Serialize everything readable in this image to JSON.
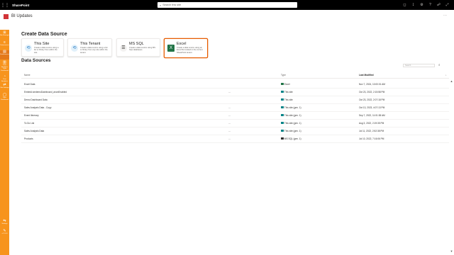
{
  "app": {
    "title": "SharePoint",
    "search_placeholder": "Search this site"
  },
  "site": {
    "name": "BI Updates",
    "more": "⋯"
  },
  "suite_icons": [
    "chat-icon",
    "share-icon",
    "settings-icon",
    "help-icon",
    "network-icon",
    "expand-icon"
  ],
  "leftnav": {
    "items": [
      {
        "icon": "⊞",
        "label": "Site Manager"
      },
      {
        "icon": "≡",
        "label": "Datasources"
      },
      {
        "icon": "▤",
        "label": "DataSources"
      },
      {
        "icon": "▥",
        "label": "Data Analytics Tools Dashboard"
      },
      {
        "icon": "◔",
        "label": "User Analytics"
      },
      {
        "icon": "⇄",
        "label": "Site Settings"
      },
      {
        "icon": "◯",
        "label": "New Dashboard"
      },
      {
        "icon": "⇆",
        "label": "Settings"
      },
      {
        "icon": "✎",
        "label": "v1.1.0.0"
      }
    ]
  },
  "create": {
    "heading": "Create Data Source",
    "cards": [
      {
        "title": "This Site",
        "description": "Create a data source using a list or library from within the site.",
        "icon": "sharepoint-icon"
      },
      {
        "title": "This Tenant",
        "description": "Create a data source using a list or library from any site within the tenant.",
        "icon": "sharepoint-icon"
      },
      {
        "title": "MS SQL",
        "description": "Create a data source using MS SQL databases.",
        "icon": "database-icon"
      },
      {
        "title": "Excel",
        "description": "Create a data source using an Excel file located in the current SharePoint tenant.",
        "icon": "excel-icon"
      }
    ]
  },
  "sources": {
    "heading": "Data Sources",
    "filter_placeholder": "Search...",
    "columns": {
      "name": "Name",
      "type": "Type",
      "modified": "Last Modified"
    },
    "more": "⋯",
    "rows": [
      {
        "name": "Excel Data",
        "type": "Excel",
        "modified": "Nov 7, 2024, 10:00:01 AM",
        "color": "#217346",
        "more": false
      },
      {
        "name": "EmbedLivedemoDashboard_anonEnabled",
        "type": "This site",
        "modified": "Oct 23, 2022, 2:15:58 PM",
        "color": "#038387",
        "more": true
      },
      {
        "name": "Demo Dashboard Data",
        "type": "This site",
        "modified": "Oct 23, 2022, 2:07:18 PM",
        "color": "#038387",
        "more": false
      },
      {
        "name": "Sales Analysis Data - Copy",
        "type": "This site (gen. 1)",
        "modified": "Oct 13, 2023, 4:07:13 PM",
        "color": "#038387",
        "more": true
      },
      {
        "name": "Event Itinerary",
        "type": "This site (gen. 1)",
        "modified": "Sep 7, 2022, 11:01:38 AM",
        "color": "#038387",
        "more": true
      },
      {
        "name": "To Do List",
        "type": "This site (gen. 1)",
        "modified": "Aug 3, 2022, 2:19:35 PM",
        "color": "#038387",
        "more": true
      },
      {
        "name": "Sales Analysis Data",
        "type": "This site (gen. 1)",
        "modified": "Jul 11, 2022, 2:52:38 PM",
        "color": "#038387",
        "more": true
      },
      {
        "name": "Products",
        "type": "MS SQL (gen. 1)",
        "modified": "Jul 10, 2022, 7:16:06 PM",
        "color": "#323130",
        "more": true
      }
    ]
  }
}
